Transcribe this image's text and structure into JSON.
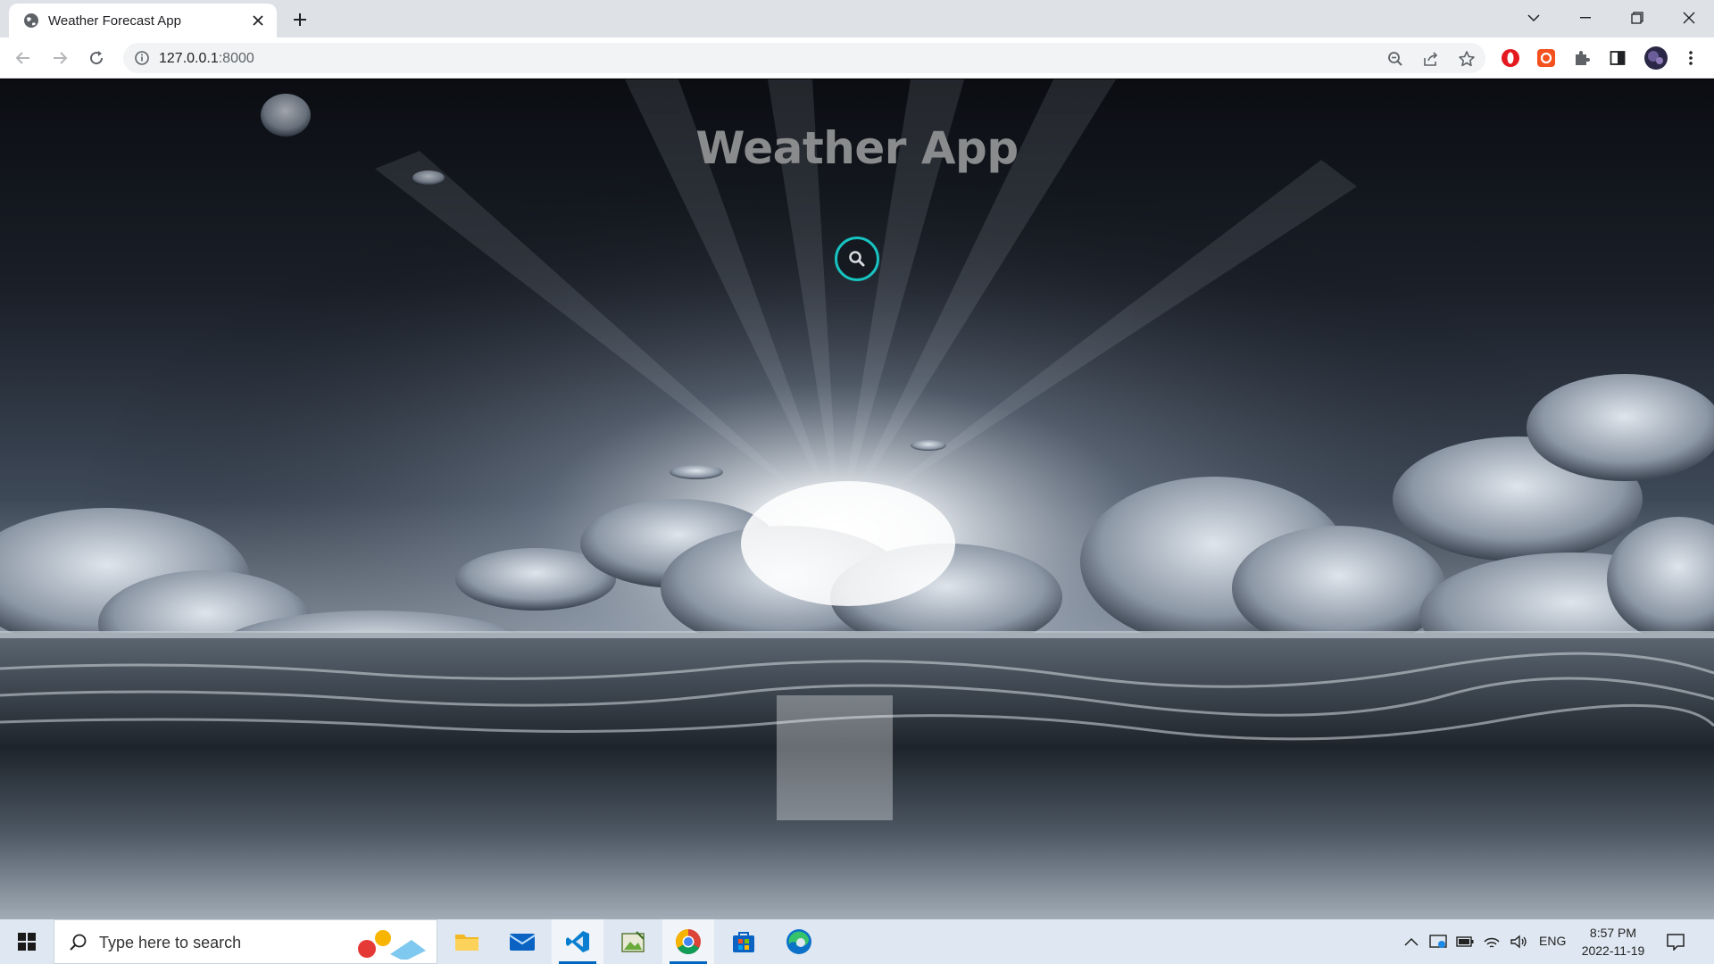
{
  "browser": {
    "tab_title": "Weather Forecast App",
    "url_host": "127.0.0.1",
    "url_port": ":8000"
  },
  "page": {
    "title": "Weather App",
    "search_icon": "search-icon",
    "accent_color": "#17c3c0",
    "title_color": "#8a8b8d"
  },
  "taskbar": {
    "search_placeholder": "Type here to search",
    "apps": [
      "file-explorer-icon",
      "mail-icon",
      "vscode-icon",
      "photos-icon",
      "chrome-icon",
      "store-icon",
      "edge-icon"
    ],
    "language": "ENG",
    "time": "8:57 PM",
    "date": "2022-11-19"
  }
}
